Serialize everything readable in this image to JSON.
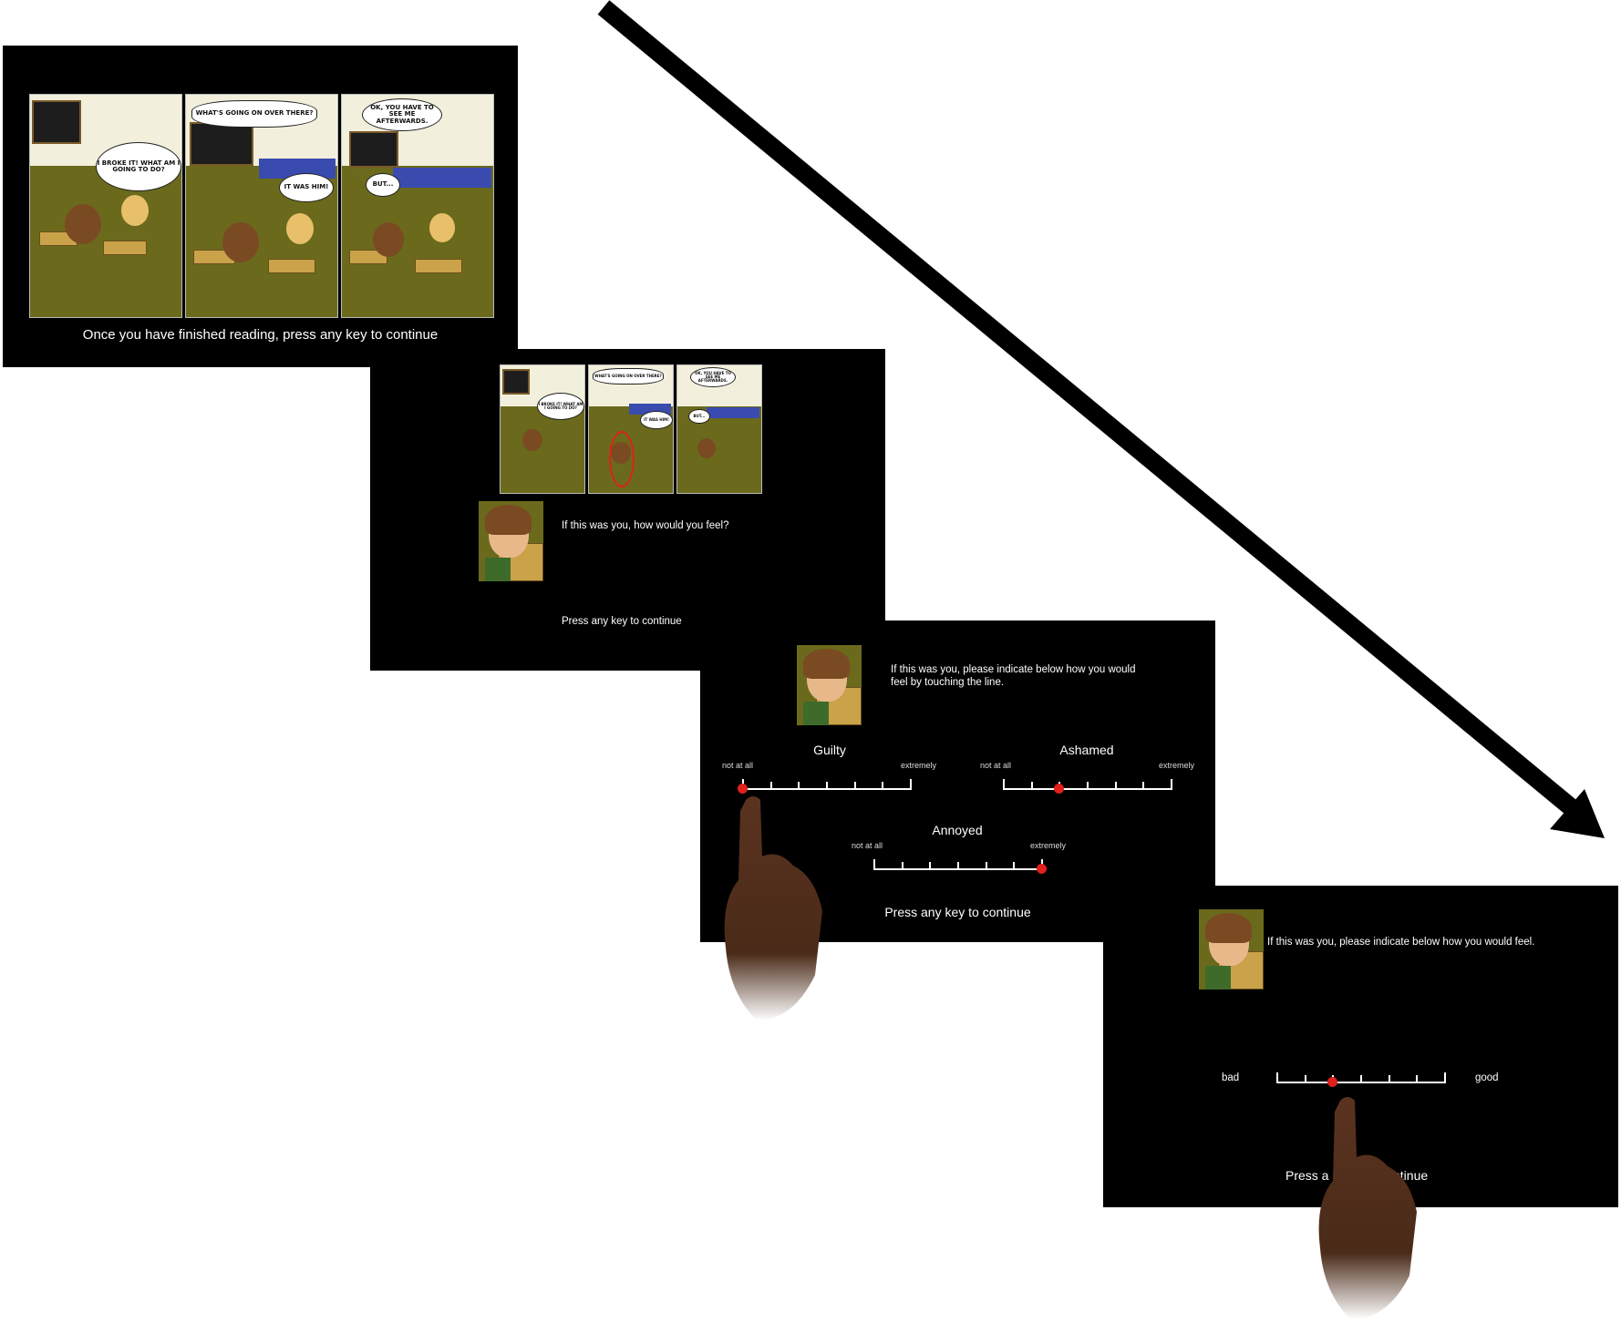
{
  "screens": {
    "s1": {
      "caption": "Once you have finished reading, press any key to continue",
      "bubbles": [
        "WHAT'S GOING ON OVER THERE?",
        "OK, YOU HAVE TO SEE ME AFTERWARDS.",
        "I BROKE IT! WHAT AM I GOING TO DO?",
        "IT WAS HIM!",
        "BUT..."
      ]
    },
    "s2": {
      "question": "If this was you, how would you feel?",
      "continue": "Press any key to continue",
      "bubbles": [
        "WHAT'S GOING ON OVER THERE?",
        "OK, YOU HAVE TO SEE ME AFTERWARDS.",
        "I BROKE IT! WHAT AM I GOING TO DO?",
        "IT WAS HIM!",
        "BUT..."
      ]
    },
    "s3": {
      "instruction": "If this was you, please indicate below how you would feel by touching the line.",
      "scales": [
        {
          "label": "Guilty",
          "low": "not at all",
          "high": "extremely",
          "value": 0.0
        },
        {
          "label": "Ashamed",
          "low": "not at all",
          "high": "extremely",
          "value": 0.33
        },
        {
          "label": "Annoyed",
          "low": "not at all",
          "high": "extremely",
          "value": 1.0
        }
      ],
      "continue": "Press any key to continue"
    },
    "s4": {
      "instruction": "If this was you, please indicate below how you would feel.",
      "low": "bad",
      "high": "good",
      "value": 0.33,
      "continue_left": "Press a",
      "continue_right": "ntinue"
    }
  },
  "colors": {
    "screen_bg": "#000000",
    "marker": "#e0201a",
    "arrow": "#000000"
  },
  "icons": [
    "pointing-finger-icon",
    "arrow-icon"
  ]
}
